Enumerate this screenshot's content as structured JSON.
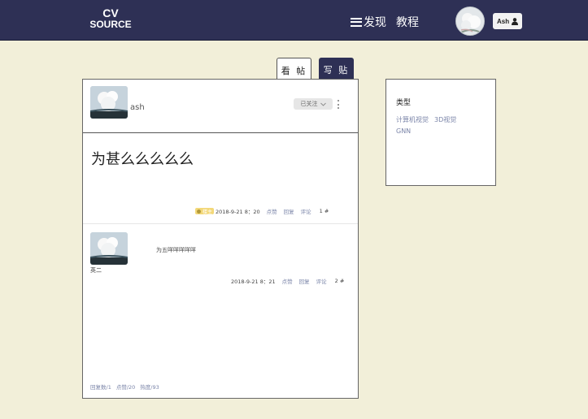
{
  "brand": {
    "line1": "CV",
    "line2": "SOURCE"
  },
  "nav": {
    "discover_label": "发现",
    "tutorial_label": "教程",
    "username": "Ash"
  },
  "tabs": {
    "view_label": "看 帖",
    "write_label": "写 贴"
  },
  "post": {
    "author": "ash",
    "follow_label": "已关注",
    "title": "为甚么么么么么",
    "badge_label": "楼主",
    "datetime": "2018-9-21  8：20",
    "like_label": "点赞",
    "reply_label": "回复",
    "comment_label": "评论",
    "floor": "1 #"
  },
  "reply": {
    "text": "为五咩咩咩咩咩",
    "author": "英二",
    "datetime": "2018-9-21  8：21",
    "like_label": "点赞",
    "reply_label": "回复",
    "comment_label": "评论",
    "floor": "2 #"
  },
  "stats": {
    "replies": "回复数/1",
    "likes": "点赞/20",
    "heat": "热度/93"
  },
  "sidebar": {
    "title": "类型",
    "tags": [
      "计算机视觉",
      "3D视觉",
      "GNN"
    ]
  },
  "colors": {
    "navbar": "#2e3055",
    "page_bg": "#f2efd9",
    "link": "#7a84a8",
    "badge": "#f3d879"
  },
  "icons": [
    "menu-icon",
    "user-icon",
    "chevron-down-icon",
    "more-vertical-icon",
    "badge-icon"
  ]
}
